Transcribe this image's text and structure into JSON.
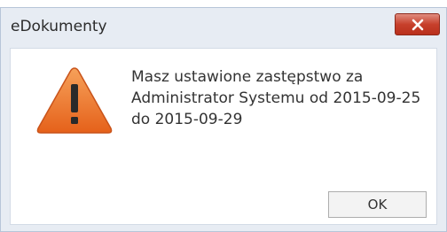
{
  "window": {
    "title": "eDokumenty"
  },
  "dialog": {
    "icon": "warning-icon",
    "message": "Masz ustawione zastępstwo za Administrator Systemu od 2015-09-25 do 2015-09-29",
    "ok_label": "OK"
  },
  "colors": {
    "close_button": "#c7402c",
    "warning_fill": "#ee7a2a",
    "window_frame": "#e7ecf3"
  }
}
